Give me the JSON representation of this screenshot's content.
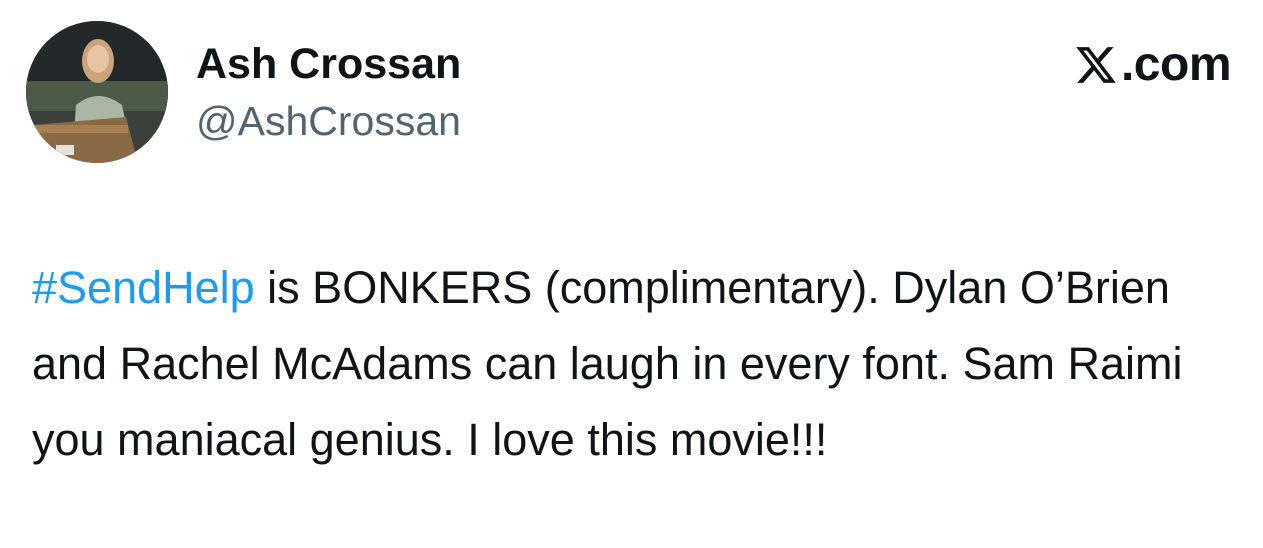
{
  "tweet": {
    "author": {
      "display_name": "Ash Crossan",
      "handle": "@AshCrossan",
      "avatar_icon": "profile-photo"
    },
    "brand": {
      "logo_icon": "x-logo-icon",
      "label": ".com"
    },
    "body": {
      "hashtag": "#SendHelp",
      "text": " is BONKERS (complimentary). Dylan O’Brien and Rachel McAdams can laugh in every font. Sam Raimi you maniacal genius. I love this movie!!!"
    }
  },
  "colors": {
    "hashtag": "#1d9bf0",
    "handle": "#536471",
    "text": "#0f1419",
    "background": "#ffffff"
  }
}
